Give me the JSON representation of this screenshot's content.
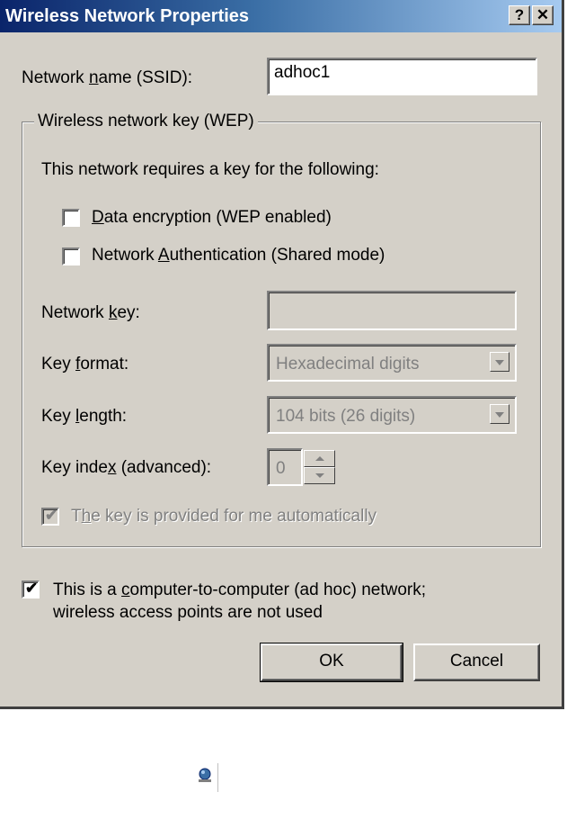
{
  "window": {
    "title": "Wireless Network Properties",
    "help_button": "?",
    "close_button": "✕"
  },
  "ssid": {
    "label_pre": "Network ",
    "label_u": "n",
    "label_post": "ame (SSID):",
    "value": "adhoc1"
  },
  "group": {
    "title": "Wireless network key (WEP)",
    "intro": "This network requires a key for the following:",
    "data_encryption": {
      "label_u": "D",
      "label_post": "ata encryption (WEP enabled)",
      "checked": false
    },
    "network_auth": {
      "label_pre": "Network ",
      "label_u": "A",
      "label_post": "uthentication (Shared mode)",
      "checked": false
    },
    "network_key": {
      "label_pre": "Network ",
      "label_u": "k",
      "label_post": "ey:",
      "value": ""
    },
    "key_format": {
      "label_pre": "Key ",
      "label_u": "f",
      "label_post": "ormat:",
      "selected": "Hexadecimal digits"
    },
    "key_length": {
      "label_pre": "Key ",
      "label_u": "l",
      "label_post": "ength:",
      "selected": "104 bits (26 digits)"
    },
    "key_index": {
      "label_pre": "Key inde",
      "label_u": "x",
      "label_post": " (advanced):",
      "value": "0"
    },
    "auto_key": {
      "label_pre": "T",
      "label_u": "h",
      "label_post": "e key is provided for me automatically",
      "checked": true
    }
  },
  "adhoc": {
    "label_line1_pre": "This is a ",
    "label_line1_u": "c",
    "label_line1_post": "omputer-to-computer (ad hoc) network;",
    "label_line2": "wireless access points are not used",
    "checked": true
  },
  "buttons": {
    "ok": "OK",
    "cancel": "Cancel"
  },
  "check_glyph": "✔",
  "colors": {
    "title_start": "#0a246a",
    "title_end": "#a6caf0",
    "face": "#d4d0c8"
  }
}
